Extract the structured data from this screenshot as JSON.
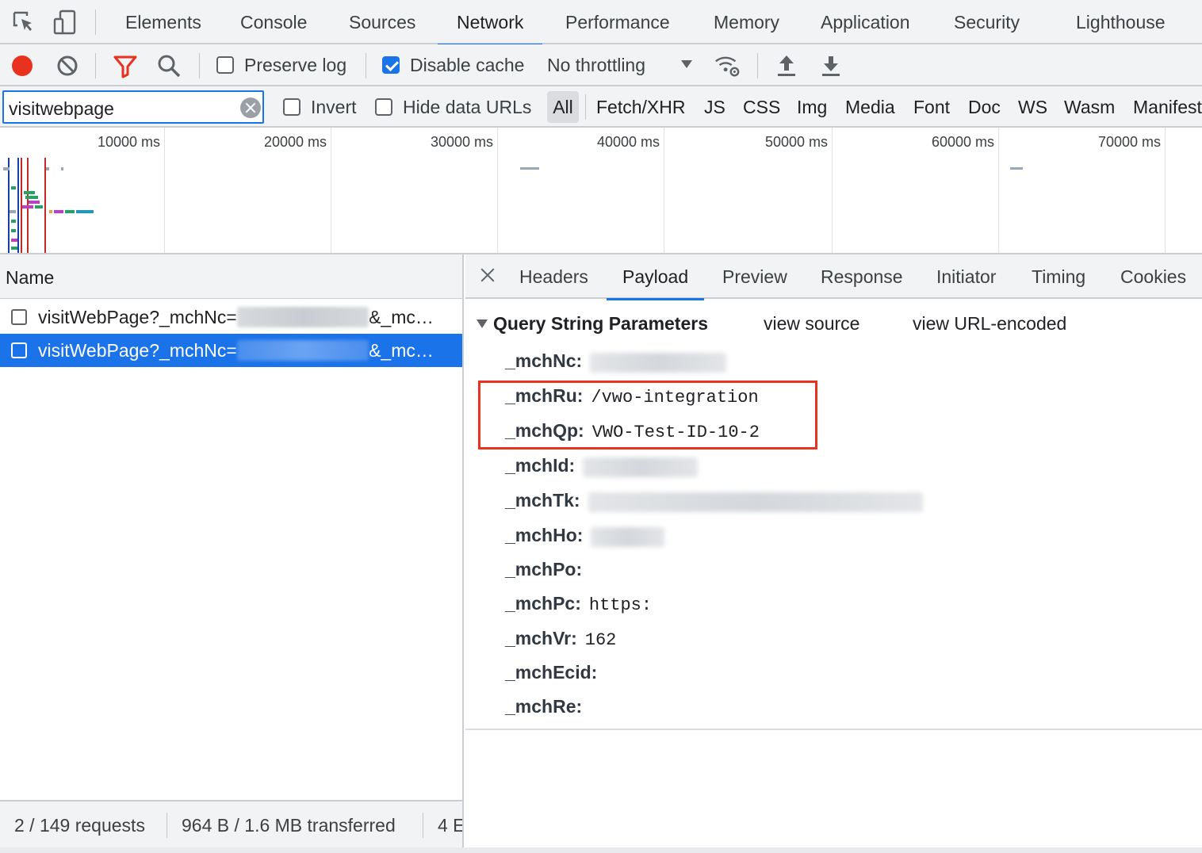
{
  "devtools_tabs": [
    {
      "label": "Elements",
      "active": false
    },
    {
      "label": "Console",
      "active": false
    },
    {
      "label": "Sources",
      "active": false
    },
    {
      "label": "Network",
      "active": true
    },
    {
      "label": "Performance",
      "active": false
    },
    {
      "label": "Memory",
      "active": false
    },
    {
      "label": "Application",
      "active": false
    },
    {
      "label": "Security",
      "active": false
    },
    {
      "label": "Lighthouse",
      "active": false
    }
  ],
  "toolbar": {
    "preserve_log_label": "Preserve log",
    "preserve_log_checked": false,
    "disable_cache_label": "Disable cache",
    "disable_cache_checked": true,
    "throttling_value": "No throttling"
  },
  "filter": {
    "value": "visitwebpage",
    "invert_label": "Invert",
    "hide_data_urls_label": "Hide data URLs",
    "types": [
      "All",
      "Fetch/XHR",
      "JS",
      "CSS",
      "Img",
      "Media",
      "Font",
      "Doc",
      "WS",
      "Wasm",
      "Manifest"
    ],
    "active_type": "All"
  },
  "overview": {
    "ticks": [
      "10000 ms",
      "20000 ms",
      "30000 ms",
      "40000 ms",
      "50000 ms",
      "60000 ms",
      "70000 ms"
    ]
  },
  "request_list": {
    "header": "Name",
    "rows": [
      {
        "prefix": "visitWebPage?_mchNc=",
        "hidden": "1669791638319",
        "suffix": "&_mc…",
        "selected": false
      },
      {
        "prefix": "visitWebPage?_mchNc=",
        "hidden": "1669791701813",
        "suffix": "&_mc…",
        "selected": true
      }
    ]
  },
  "status": {
    "requests": "2 / 149 requests",
    "transferred": "964 B / 1.6 MB transferred",
    "resources": "4 E"
  },
  "details": {
    "tabs": [
      {
        "label": "Headers",
        "active": false
      },
      {
        "label": "Payload",
        "active": true
      },
      {
        "label": "Preview",
        "active": false
      },
      {
        "label": "Response",
        "active": false
      },
      {
        "label": "Initiator",
        "active": false
      },
      {
        "label": "Timing",
        "active": false
      },
      {
        "label": "Cookies",
        "active": false
      }
    ],
    "section_title": "Query String Parameters",
    "view_source": "view source",
    "view_url_encoded": "view URL-encoded",
    "params": [
      {
        "key": "_mchNc:",
        "value": "1669791701813",
        "blurred": true
      },
      {
        "key": "_mchRu:",
        "value": "/vwo-integration",
        "blurred": false
      },
      {
        "key": "_mchQp:",
        "value": "VWO-Test-ID-10-2",
        "blurred": false
      },
      {
        "key": "_mchId:",
        "value": "687-100-335",
        "blurred": true
      },
      {
        "key": "_mchTk:",
        "value": "_mch-vwo.com-1662403888851-28561",
        "blurred": true
      },
      {
        "key": "_mchHo:",
        "value": "vwo.com",
        "blurred": true
      },
      {
        "key": "_mchPo:",
        "value": "",
        "blurred": false
      },
      {
        "key": "_mchPc:",
        "value": "https:",
        "blurred": false
      },
      {
        "key": "_mchVr:",
        "value": "162",
        "blurred": false
      },
      {
        "key": "_mchEcid:",
        "value": "",
        "blurred": false
      },
      {
        "key": "_mchRe:",
        "value": "",
        "blurred": false
      }
    ]
  },
  "colors": {
    "accent": "#1a73e8",
    "record": "#e8311f",
    "highlight": "#e8311f"
  }
}
